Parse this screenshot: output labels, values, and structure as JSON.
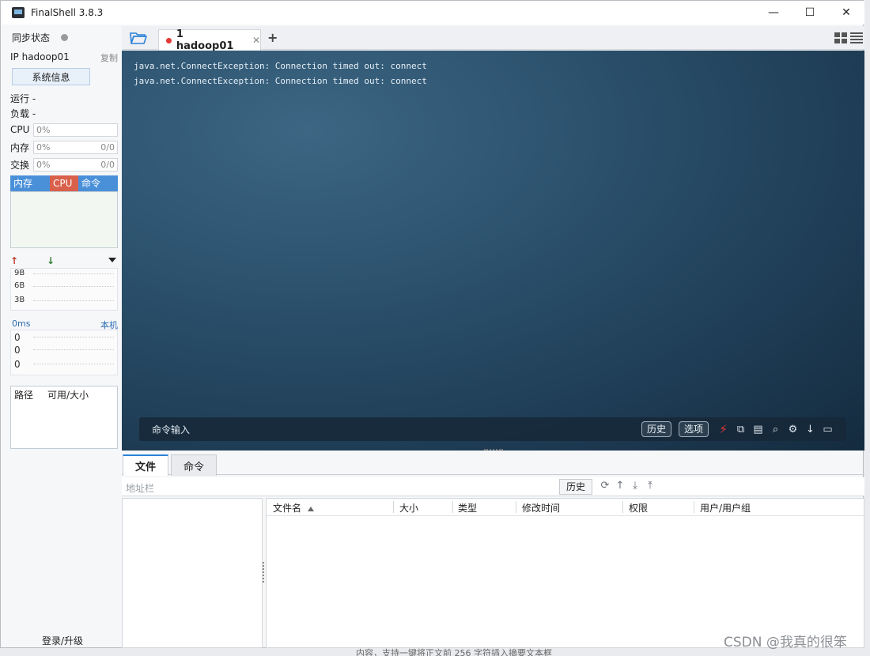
{
  "window": {
    "title": "FinalShell 3.8.3",
    "controls": [
      "—",
      "☐",
      "✕"
    ]
  },
  "sidebar": {
    "sync_label": "同步状态",
    "ip_label": "IP hadoop01",
    "copy_label": "复制",
    "sysinfo_button": "系统信息",
    "run_label": "运行 -",
    "load_label": "负载 -",
    "meters": [
      {
        "label": "CPU",
        "value": "0%",
        "extra": ""
      },
      {
        "label": "内存",
        "value": "0%",
        "extra": "0/0"
      },
      {
        "label": "交换",
        "value": "0%",
        "extra": "0/0"
      }
    ],
    "process_tabs": [
      "内存",
      "CPU",
      "命令"
    ],
    "net_ticks": [
      "9B",
      "6B",
      "3B"
    ],
    "ping_label": "0ms",
    "ping_host": "本机",
    "ping_ticks": [
      "0",
      "0",
      "0"
    ],
    "disk_cols": [
      "路径",
      "可用/大小"
    ],
    "login_link": "登录/升级"
  },
  "tabs": {
    "active_label": "1 hadoop01",
    "add_symbol": "+"
  },
  "terminal": {
    "lines": [
      "java.net.ConnectException: Connection timed out: connect",
      "java.net.ConnectException: Connection timed out: connect"
    ],
    "command_input_label": "命令输入",
    "history_button": "历史",
    "options_button": "选项"
  },
  "bottom": {
    "tabs": [
      "文件",
      "命令"
    ],
    "address_placeholder": "地址栏",
    "history_button": "历史",
    "columns": [
      "文件名",
      "大小",
      "类型",
      "修改时间",
      "权限",
      "用户/用户组"
    ]
  },
  "background": {
    "bottom_text": "内容，支持一键将正文前 256 字符插入摘要文本框",
    "watermark": "CSDN @我真的很笨"
  },
  "colors": {
    "accent": "#2b82d9",
    "proc_tab_mem": "#4a90d9",
    "proc_tab_cpu": "#d9604a",
    "terminal_bg": "#2c526e"
  }
}
